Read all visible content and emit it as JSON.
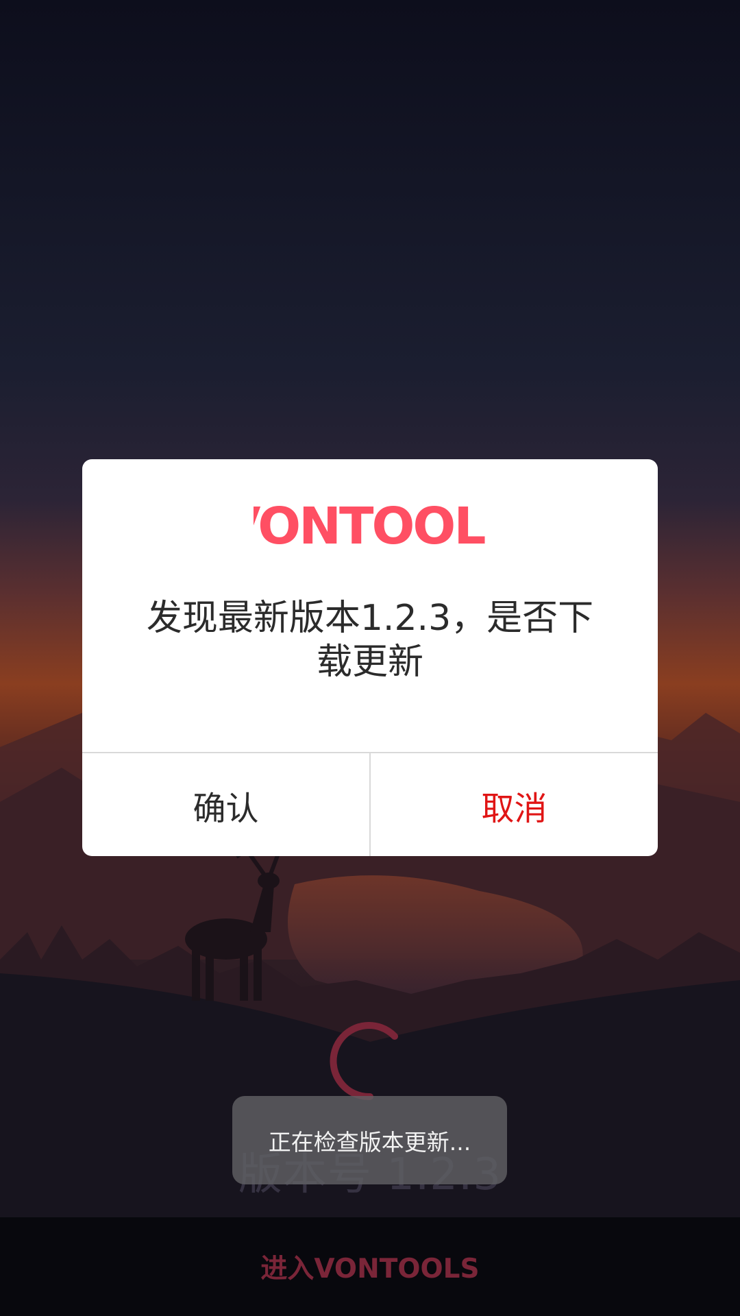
{
  "app": {
    "brand": "VONTOOLS",
    "brand_color": "#ff4f63"
  },
  "background": {
    "version_label": "版本号 1.2.3",
    "spinner_color": "#7a2538",
    "scene": "dusk mountain landscape with deer silhouette"
  },
  "dialog": {
    "logo_text": "VONTOOLS",
    "message": "发现最新版本1.2.3，是否下载更新",
    "confirm_label": "确认",
    "cancel_label": "取消",
    "cancel_color": "#e01515"
  },
  "toast": {
    "text": "正在检查版本更新..."
  },
  "bottom_bar": {
    "enter_label": "进入VONTOOLS"
  }
}
